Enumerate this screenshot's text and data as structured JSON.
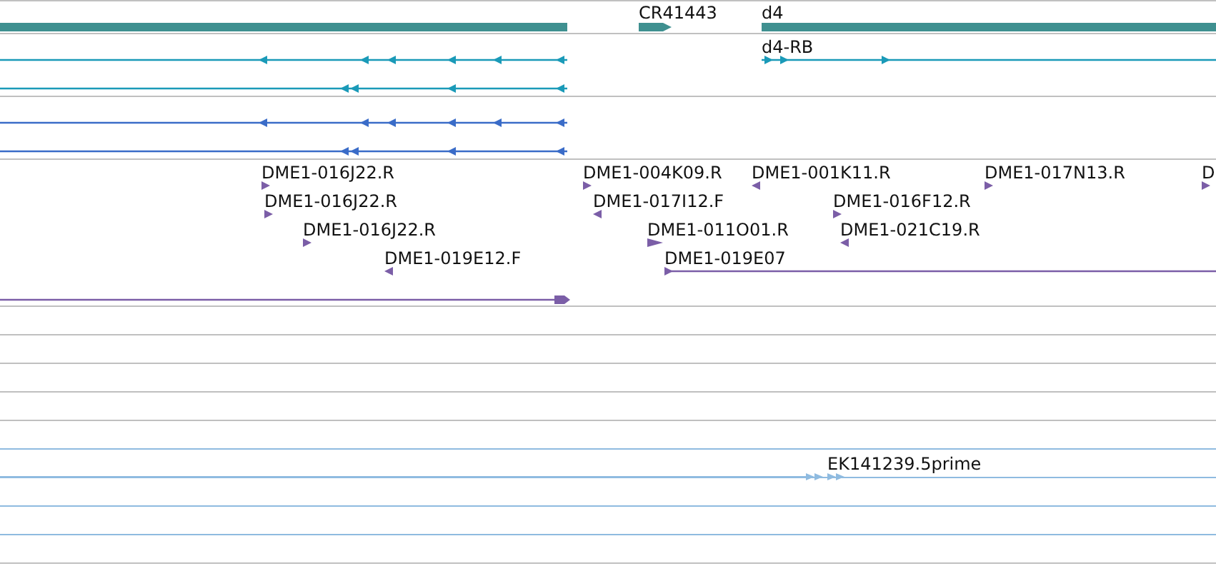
{
  "gene_track": {
    "genes": [
      {
        "label": "CR41443",
        "reverse": false
      },
      {
        "label": "d4"
      }
    ]
  },
  "transcript_track": {
    "transcripts": [
      {
        "label": "d4-RB",
        "reverse": false
      }
    ]
  },
  "est_track": {
    "features": [
      {
        "label": "DME1-016J22.R",
        "reverse": false
      },
      {
        "label": "DME1-016J22.R",
        "reverse": false
      },
      {
        "label": "DME1-016J22.R",
        "reverse": false
      },
      {
        "label": "DME1-019E12.F",
        "reverse": true
      },
      {
        "label": "DME1-004K09.R",
        "reverse": false
      },
      {
        "label": "DME1-017I12.F",
        "reverse": true
      },
      {
        "label": "DME1-011O01.R",
        "reverse": false
      },
      {
        "label": "DME1-019E07",
        "reverse": false
      },
      {
        "label": "DME1-001K11.R",
        "reverse": true
      },
      {
        "label": "DME1-016F12.R",
        "reverse": false
      },
      {
        "label": "DME1-021C19.R",
        "reverse": true
      },
      {
        "label": "DME1-017N13.R",
        "reverse": false
      },
      {
        "label": "D",
        "reverse": false
      }
    ]
  },
  "read_track": {
    "reads": [
      {
        "label": "EK141239.5prime",
        "reverse": false
      }
    ]
  }
}
